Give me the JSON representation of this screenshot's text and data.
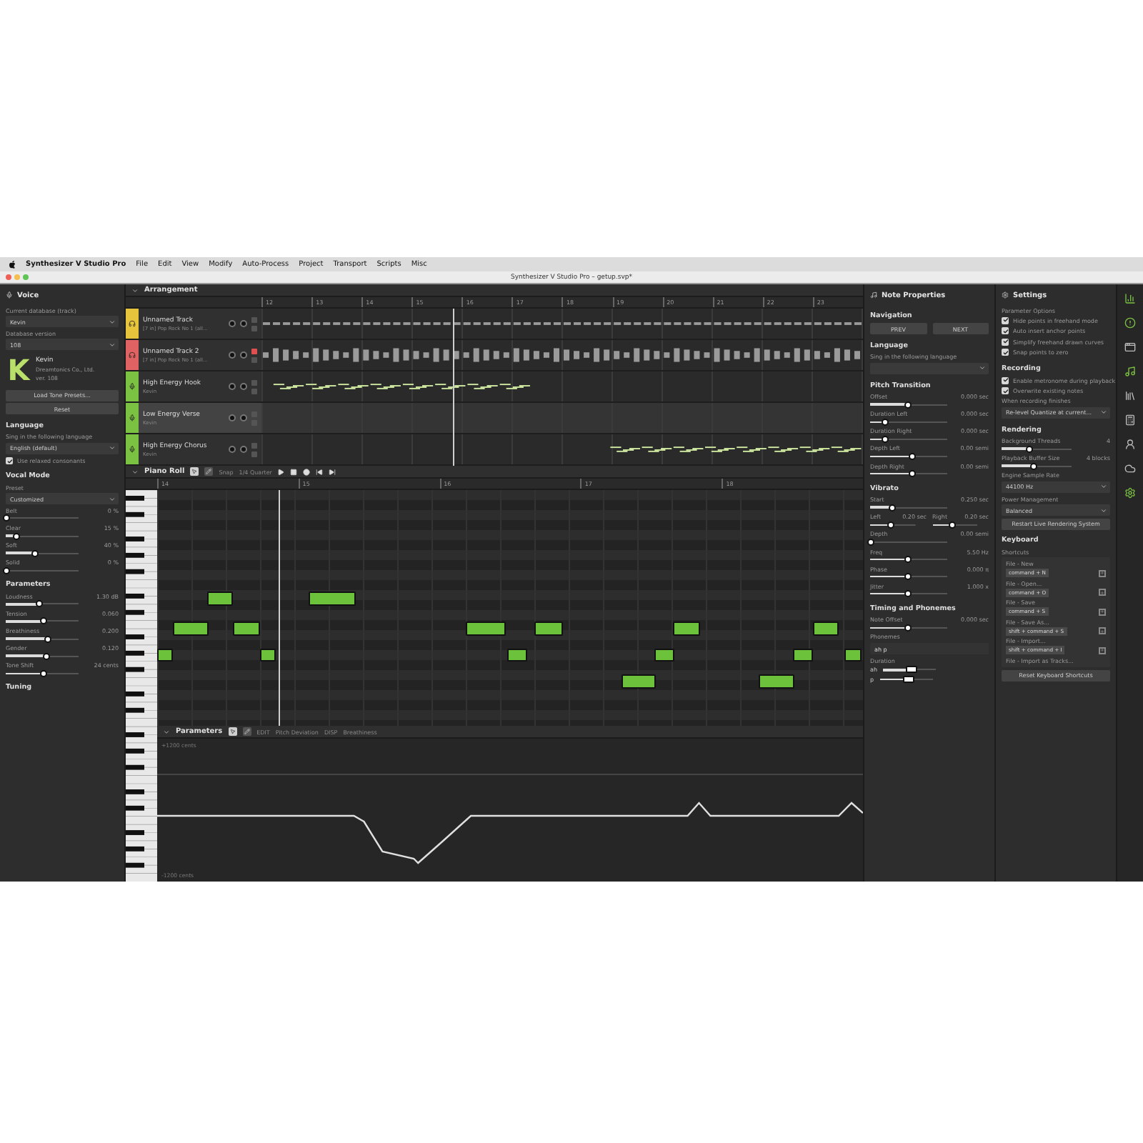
{
  "menu_bar": {
    "app": "Synthesizer V Studio Pro",
    "items": [
      "File",
      "Edit",
      "View",
      "Modify",
      "Auto-Process",
      "Project",
      "Transport",
      "Scripts",
      "Misc"
    ]
  },
  "window": {
    "title": "Synthesizer V Studio Pro – getup.svp*"
  },
  "voice_panel": {
    "title": "Voice",
    "rows": [
      {
        "kind": "label",
        "text": "Current database (track)"
      },
      {
        "kind": "dropdown",
        "value": "Kevin"
      },
      {
        "kind": "label",
        "text": "Database version"
      },
      {
        "kind": "dropdown",
        "value": "108"
      },
      {
        "kind": "voice_card",
        "letter": "K",
        "name": "Kevin",
        "vendor": "Dreamtonics Co., Ltd.",
        "version": "ver. 108"
      },
      {
        "kind": "button",
        "text": "Load Tone Presets..."
      },
      {
        "kind": "button",
        "text": "Reset"
      },
      {
        "kind": "heading",
        "text": "Language"
      },
      {
        "kind": "label",
        "text": "Sing in the following language"
      },
      {
        "kind": "dropdown",
        "value": "English (default)"
      },
      {
        "kind": "checkbox",
        "text": "Use relaxed consonants",
        "checked": true
      },
      {
        "kind": "heading",
        "text": "Vocal Mode"
      },
      {
        "kind": "label",
        "text": "Preset"
      },
      {
        "kind": "dropdown",
        "value": "Customized"
      },
      {
        "kind": "slider",
        "label": "Belt",
        "reading": "0 %",
        "level": 0
      },
      {
        "kind": "slider",
        "label": "Clear",
        "reading": "15 %",
        "level": 0.15
      },
      {
        "kind": "slider",
        "label": "Soft",
        "reading": "40 %",
        "level": 0.4
      },
      {
        "kind": "slider",
        "label": "Solid",
        "reading": "0 %",
        "level": 0
      },
      {
        "kind": "heading",
        "text": "Parameters"
      },
      {
        "kind": "slider",
        "label": "Loudness",
        "reading": "1.30 dB",
        "level": 0.45
      },
      {
        "kind": "slider",
        "label": "Tension",
        "reading": "0.060",
        "level": 0.52
      },
      {
        "kind": "slider",
        "label": "Breathiness",
        "reading": "0.200",
        "level": 0.58
      },
      {
        "kind": "slider",
        "label": "Gender",
        "reading": "0.120",
        "level": 0.55
      },
      {
        "kind": "slider",
        "label": "Tone Shift",
        "reading": "24 cents",
        "level": 0.51
      },
      {
        "kind": "heading",
        "text": "Tuning"
      }
    ]
  },
  "arrangement": {
    "title": "Arrangement",
    "bars": [
      "12",
      "13",
      "14",
      "15",
      "16",
      "17",
      "18",
      "19",
      "20",
      "21",
      "22",
      "23"
    ],
    "tracks": [
      {
        "kind": "audio",
        "name": "Unnamed Track",
        "source": "[7 in] Pop Rock No 1 (all...",
        "color": "#e6c43c",
        "muted": false,
        "selected": false
      },
      {
        "kind": "audio",
        "name": "Unnamed Track 2",
        "source": "[7 in] Pop Rock No 1 (all...",
        "color": "#e06262",
        "muted": true,
        "selected": false
      },
      {
        "kind": "vocal",
        "name": "High Energy Hook",
        "source": "Kevin",
        "color": "#7cc242",
        "muted": false,
        "selected": false
      },
      {
        "kind": "vocal",
        "name": "Low Energy Verse",
        "source": "Kevin",
        "color": "#7cc242",
        "muted": false,
        "selected": true
      },
      {
        "kind": "vocal",
        "name": "High Energy Chorus",
        "source": "Kevin",
        "color": "#7cc242",
        "muted": false,
        "selected": false
      }
    ]
  },
  "piano_roll": {
    "title": "Piano Roll",
    "snap_label": "Snap",
    "snap_value": "1/4 Quarter",
    "bars": [
      "14",
      "15",
      "16",
      "17",
      "18"
    ]
  },
  "parameters": {
    "title": "Parameters",
    "edit_label": "EDIT",
    "edit_value": "Pitch Deviation",
    "disp_label": "DISP",
    "disp_value": "Breathiness",
    "top_label": "+1200 cents",
    "bottom_label": "-1200 cents"
  },
  "note_panel": {
    "title": "Note Properties",
    "rows": [
      {
        "kind": "heading",
        "text": "Navigation"
      },
      {
        "kind": "buttons",
        "items": [
          "PREV",
          "NEXT"
        ]
      },
      {
        "kind": "heading",
        "text": "Language"
      },
      {
        "kind": "label",
        "text": "Sing in the following language"
      },
      {
        "kind": "dropdown"
      },
      {
        "kind": "heading",
        "text": "Pitch Transition"
      },
      {
        "kind": "slider",
        "label": "Offset",
        "reading": "0.000 sec",
        "level": 0.5
      },
      {
        "kind": "slider",
        "label": "Duration Left",
        "reading": "0.000 sec",
        "level": 0.2
      },
      {
        "kind": "slider",
        "label": "Duration Right",
        "reading": "0.000 sec",
        "level": 0.2
      },
      {
        "kind": "slider",
        "label": "Depth Left",
        "reading": "0.00 semi",
        "level": 0.55
      },
      {
        "kind": "slider",
        "label": "Depth Right",
        "reading": "0.00 semi",
        "level": 0.55
      },
      {
        "kind": "heading",
        "text": "Vibrato"
      },
      {
        "kind": "slider",
        "label": "Start",
        "reading": "0.250 sec",
        "level": 0.28
      },
      {
        "kind": "lr_slider",
        "items": [
          {
            "label": "Left",
            "reading": "0.20 sec",
            "level": 0.45
          },
          {
            "label": "Right",
            "reading": "0.20 sec",
            "level": 0.45
          }
        ]
      },
      {
        "kind": "slider",
        "label": "Depth",
        "reading": "0.00 semi",
        "level": 0
      },
      {
        "kind": "slider",
        "label": "Freq",
        "reading": "5.50 Hz",
        "level": 0.5
      },
      {
        "kind": "slider",
        "label": "Phase",
        "reading": "0.000 π",
        "level": 0.5
      },
      {
        "kind": "slider",
        "label": "Jitter",
        "reading": "1.000 x",
        "level": 0.5
      },
      {
        "kind": "heading",
        "text": "Timing and Phonemes"
      },
      {
        "kind": "slider",
        "label": "Note Offset",
        "reading": "0.000 sec",
        "level": 0.5
      },
      {
        "kind": "label",
        "text": "Phonemes"
      },
      {
        "kind": "field",
        "value": "ah p"
      },
      {
        "kind": "label",
        "text": "Duration"
      },
      {
        "kind": "mini_slider",
        "label": "ah",
        "level": 0.5
      },
      {
        "kind": "mini_slider",
        "label": "p",
        "level": 0.5
      }
    ]
  },
  "settings_panel": {
    "title": "Settings",
    "rows": [
      {
        "kind": "label",
        "text": "Parameter Options"
      },
      {
        "kind": "checkbox",
        "text": "Hide points in freehand mode",
        "checked": true
      },
      {
        "kind": "checkbox",
        "text": "Auto insert anchor points",
        "checked": true
      },
      {
        "kind": "checkbox",
        "text": "Simplify freehand drawn curves",
        "checked": true
      },
      {
        "kind": "checkbox",
        "text": "Snap points to zero",
        "checked": true
      },
      {
        "kind": "heading",
        "text": "Recording"
      },
      {
        "kind": "checkbox",
        "text": "Enable metronome during playback",
        "checked": true
      },
      {
        "kind": "checkbox",
        "text": "Overwrite existing notes",
        "checked": true
      },
      {
        "kind": "label",
        "text": "When recording finishes"
      },
      {
        "kind": "dropdown",
        "value": "Re-level Quantize at current..."
      },
      {
        "kind": "heading",
        "text": "Rendering"
      },
      {
        "kind": "slider",
        "label": "Background Threads",
        "reading": "4",
        "level": 0.4
      },
      {
        "kind": "slider",
        "label": "Playback Buffer Size",
        "reading": "4 blocks",
        "level": 0.45
      },
      {
        "kind": "label",
        "text": "Engine Sample Rate"
      },
      {
        "kind": "dropdown",
        "value": "44100 Hz"
      },
      {
        "kind": "label",
        "text": "Power Management"
      },
      {
        "kind": "dropdown",
        "value": "Balanced"
      },
      {
        "kind": "button",
        "text": "Restart Live Rendering System"
      },
      {
        "kind": "heading",
        "text": "Keyboard"
      },
      {
        "kind": "label",
        "text": "Shortcuts"
      },
      {
        "kind": "shortcuts",
        "items": [
          {
            "action": "File - New",
            "keys": "command + N"
          },
          {
            "action": "File - Open...",
            "keys": "command + O"
          },
          {
            "action": "File - Save",
            "keys": "command + S"
          },
          {
            "action": "File - Save As...",
            "keys": "shift + command + S"
          },
          {
            "action": "File - Import...",
            "keys": "shift + command + I"
          },
          {
            "action": "File - Import as Tracks..."
          }
        ]
      },
      {
        "kind": "button",
        "text": "Reset Keyboard Shortcuts"
      }
    ]
  },
  "side_icons": [
    {
      "kind": "chart",
      "active": true
    },
    {
      "kind": "alert",
      "active": true
    },
    {
      "kind": "window",
      "active": false
    },
    {
      "kind": "music",
      "active": true
    },
    {
      "kind": "books",
      "active": false
    },
    {
      "kind": "calculator",
      "active": false
    },
    {
      "kind": "person",
      "active": false
    },
    {
      "kind": "cloud",
      "active": false
    },
    {
      "kind": "gear",
      "active": true
    }
  ]
}
